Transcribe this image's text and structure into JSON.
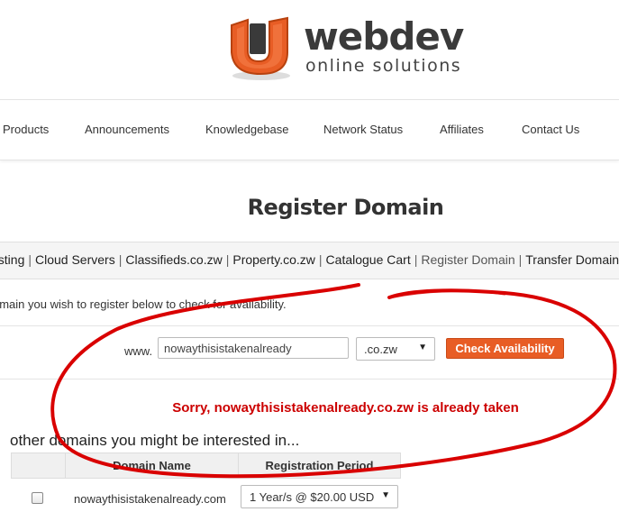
{
  "brand": {
    "name": "webdev",
    "tagline": "online solutions",
    "accent_color": "#e85d25",
    "logo_icon": "u-mark-icon"
  },
  "nav": {
    "items": [
      {
        "label": "Products"
      },
      {
        "label": "Announcements"
      },
      {
        "label": "Knowledgebase"
      },
      {
        "label": "Network Status"
      },
      {
        "label": "Affiliates"
      },
      {
        "label": "Contact Us"
      }
    ]
  },
  "page": {
    "title": "Register Domain"
  },
  "subnav": {
    "items": [
      {
        "label": "osting"
      },
      {
        "label": "Cloud Servers"
      },
      {
        "label": "Classifieds.co.zw"
      },
      {
        "label": "Property.co.zw"
      },
      {
        "label": "Catalogue Cart"
      },
      {
        "label": "Register Domain",
        "active": true
      },
      {
        "label": "Transfer Domains"
      }
    ],
    "separator": "|"
  },
  "intro": {
    "text": "omain you wish to register below to check for availability."
  },
  "search": {
    "prefix": "www.",
    "domain_value": "nowaythisistakenalready",
    "tld_selected": ".co.zw",
    "check_label": "Check Availability"
  },
  "result": {
    "message": "Sorry, nowaythisistakenalready.co.zw is already taken",
    "color": "#cc0000"
  },
  "suggestions": {
    "heading": "other domains you might be interested in...",
    "columns": [
      "",
      "Domain Name",
      "Registration Period"
    ],
    "rows": [
      {
        "domain": "nowaythisistakenalready.com",
        "period": "1 Year/s @ $20.00 USD",
        "checked": false
      }
    ]
  },
  "annotation": {
    "color": "#d90000",
    "shape": "freehand-circle"
  }
}
